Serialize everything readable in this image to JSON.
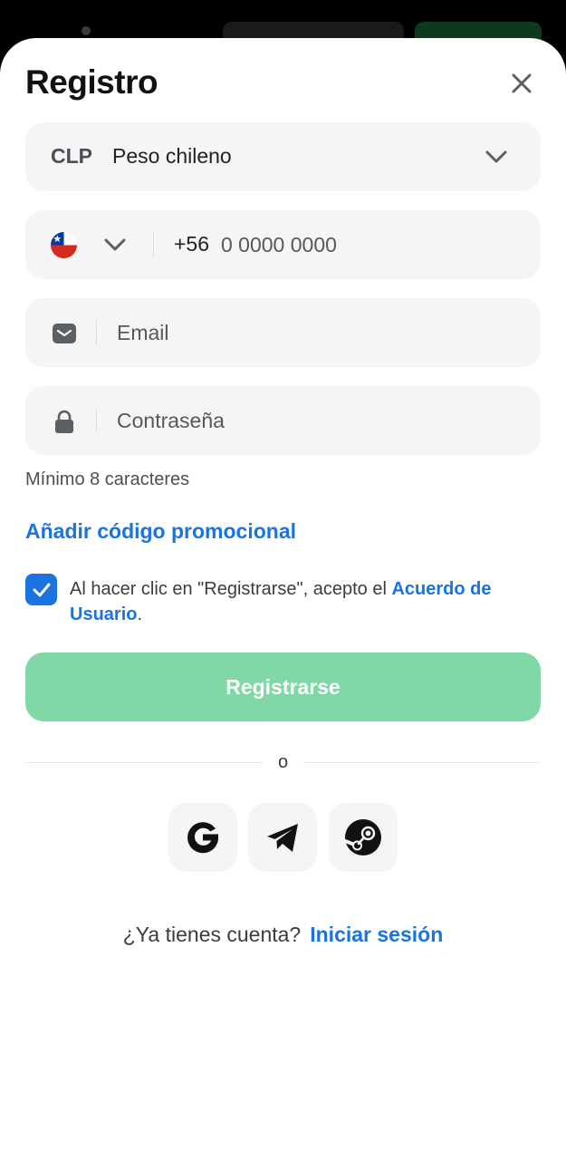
{
  "header": {
    "title": "Registro"
  },
  "currency": {
    "code": "CLP",
    "name": "Peso chileno"
  },
  "phone": {
    "prefix": "+56",
    "placeholder": "0 0000 0000",
    "country_flag": "chile-flag"
  },
  "email": {
    "placeholder": "Email"
  },
  "password": {
    "placeholder": "Contraseña",
    "hint": "Mínimo 8 caracteres"
  },
  "promo": {
    "link_label": "Añadir código promocional"
  },
  "agreement": {
    "checked": true,
    "text_before": "Al hacer clic en \"Registrarse\", acepto el ",
    "link_label": "Acuerdo de Usuario",
    "text_after": "."
  },
  "register": {
    "button_label": "Registrarse"
  },
  "divider": {
    "label": "o"
  },
  "social": [
    {
      "provider": "google",
      "icon": "google-icon"
    },
    {
      "provider": "telegram",
      "icon": "telegram-icon"
    },
    {
      "provider": "steam",
      "icon": "steam-icon"
    }
  ],
  "login": {
    "prompt": "¿Ya tienes cuenta?",
    "link_label": "Iniciar sesión"
  },
  "colors": {
    "accent": "#1a73e0",
    "register_button": "#80d8a6",
    "field_background": "#f5f5f6"
  }
}
